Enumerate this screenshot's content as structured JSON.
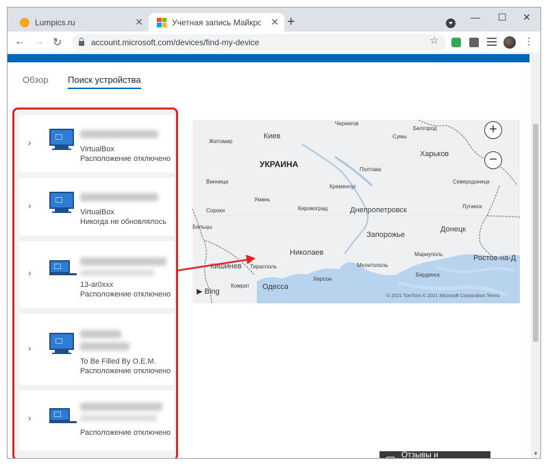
{
  "browser": {
    "tabs": [
      {
        "title": "Lumpics.ru"
      },
      {
        "title": "Учетная запись Майкрософт | У"
      }
    ],
    "address": "account.microsoft.com/devices/find-my-device",
    "icons": {
      "close": "✕",
      "newtab": "+",
      "back": "←",
      "forward": "→",
      "reload": "↻",
      "star": "☆",
      "menu": "⋮",
      "min": "—",
      "max": "☐"
    }
  },
  "page": {
    "tabs": {
      "overview": "Обзор",
      "find": "Поиск устройства"
    },
    "devices": [
      {
        "type": "desktop",
        "line1": "VirtualBox",
        "line2": "Расположение отключено"
      },
      {
        "type": "desktop",
        "line1": "VirtualBox",
        "line2": "Никогда не обновлялось"
      },
      {
        "type": "laptop",
        "line1": "13-ar0xxx",
        "line2": "Расположение отключено"
      },
      {
        "type": "desktop",
        "line1": "To Be Filled By O.E.M.",
        "line2": "Расположение отключено"
      },
      {
        "type": "laptop",
        "line1": "",
        "line2": "Расположение отключено"
      }
    ],
    "map": {
      "labels": {
        "country": "УКРАИНА",
        "kiev": "Киев",
        "zhitomir": "Житомир",
        "chernigov": "Чернигов",
        "sumy": "Сумы",
        "belgorod": "Белгород",
        "kharkov": "Харьков",
        "poltava": "Полтава",
        "vinnitsa": "Винница",
        "kremenchug": "Кременчуг",
        "severodonetsk": "Северодонецк",
        "lugansk": "Луганск",
        "uman": "Умань",
        "kirovograd": "Кировоград",
        "dnepropetrovsk": "Днепропетровск",
        "soroki": "Сороки",
        "beltsy": "Бельцы",
        "zaporozhye": "Запорожье",
        "donetsk": "Донецк",
        "nikolaev": "Николаев",
        "mariupol": "Мариуполь",
        "kishinev": "Кишинев",
        "tiraspol": "Тирасполь",
        "melitopol": "Мелитополь",
        "rostov": "Ростов-на-Д",
        "berdyansk": "Бердянск",
        "kherson": "Херсон",
        "komrat": "Комрат",
        "odessa": "Одесса"
      },
      "zoom_in": "+",
      "zoom_out": "−",
      "bing": "Bing",
      "copyright": "© 2021 TomTom  © 2021 Microsoft Corporation  Terms"
    },
    "feedback": "Отзывы и предложения",
    "colors": {
      "accent": "#0067b8",
      "highlight": "#e02323"
    }
  }
}
